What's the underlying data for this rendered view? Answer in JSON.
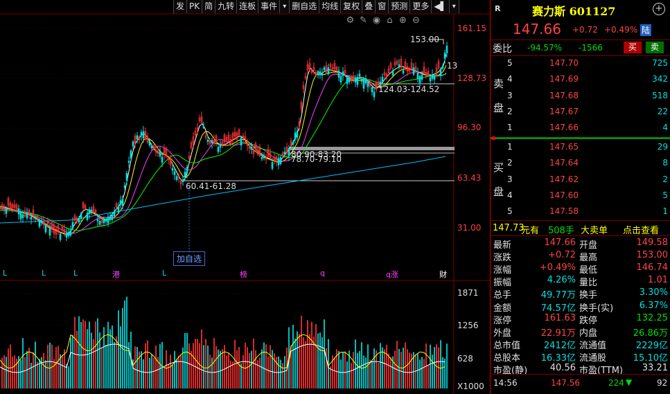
{
  "toolbar": [
    "发",
    "PK",
    "简",
    "九转",
    "连板",
    "事件",
    "▾",
    "删自选",
    "均线",
    "复权",
    "叠",
    "窗",
    "预测",
    "更多",
    "◀▌",
    "▾"
  ],
  "chart_icons": [
    "settings-icon",
    "brush-icon",
    "eye-icon",
    "house-icon",
    "zoom-in-icon",
    "zoom-out-icon"
  ],
  "price_axis": [
    "161.15",
    "128.73",
    "96.30",
    "63.43",
    "31.00"
  ],
  "volume_axis": [
    "1871",
    "1256",
    "628",
    "X1000"
  ],
  "annotations": {
    "high": "153.00",
    "range1": "124.03-124.52",
    "range2": "80.90-83.20",
    "range3": "78.70-79.10",
    "range4": "60.41-61.28",
    "cursor_label": "13",
    "add_watch": "加自选"
  },
  "markers": [
    {
      "t": "L",
      "c": "#00e0e0"
    },
    {
      "t": "L",
      "c": "#00e0e0"
    },
    {
      "t": "L",
      "c": "#00e0e0"
    },
    {
      "t": "港",
      "c": "#ff40ff"
    },
    {
      "t": "L",
      "c": "#00e0e0"
    },
    {
      "t": "榜",
      "c": "#ff40ff"
    },
    {
      "t": "q",
      "c": "#ff40ff"
    },
    {
      "t": "q涨",
      "c": "#ff40ff"
    },
    {
      "t": "财",
      "c": "#ffffff"
    }
  ],
  "stock": {
    "badge": "R",
    "name_code": "赛力斯 601127",
    "price": "147.66",
    "change": "+0.72",
    "pct": "+0.49%",
    "board": "陆",
    "ratio_label": "委比",
    "ratio": "-94.57%",
    "ratio_diff": "-1566",
    "sell_btn": "买",
    "buy_btn": "卖"
  },
  "asks": [
    {
      "lvl": "5",
      "price": "147.70",
      "vol": "725"
    },
    {
      "lvl": "4",
      "price": "147.69",
      "vol": "342"
    },
    {
      "lvl": "3",
      "price": "147.68",
      "vol": "518"
    },
    {
      "lvl": "2",
      "price": "147.67",
      "vol": "22"
    },
    {
      "lvl": "1",
      "price": "147.66",
      "vol": "4"
    }
  ],
  "bids": [
    {
      "lvl": "1",
      "price": "147.65",
      "vol": "29"
    },
    {
      "lvl": "2",
      "price": "147.64",
      "vol": "8"
    },
    {
      "lvl": "3",
      "price": "147.62",
      "vol": "2"
    },
    {
      "lvl": "4",
      "price": "147.60",
      "vol": "5"
    },
    {
      "lvl": "5",
      "price": "147.58",
      "vol": "1"
    }
  ],
  "ask_side": [
    "卖",
    "盘"
  ],
  "bid_side": [
    "买",
    "盘"
  ],
  "big_order": {
    "price": "147.73",
    "unit": "元有",
    "lots": "508手",
    "label": "大卖单",
    "action": "点击查看"
  },
  "stats": [
    {
      "l1": "最新",
      "v1": "147.66",
      "c1": "red",
      "l2": "开盘",
      "v2": "149.58",
      "c2": "red"
    },
    {
      "l1": "涨跌",
      "v1": "+0.72",
      "c1": "red",
      "l2": "最高",
      "v2": "153.00",
      "c2": "red"
    },
    {
      "l1": "涨幅",
      "v1": "+0.49%",
      "c1": "red",
      "l2": "最低",
      "v2": "146.74",
      "c2": "red"
    },
    {
      "l1": "振幅",
      "v1": "4.26%",
      "c1": "cyan",
      "l2": "量比",
      "v2": "1.01",
      "c2": "red"
    },
    {
      "l1": "总手",
      "v1": "49.77万",
      "c1": "cyan",
      "l2": "换手",
      "v2": "3.30%",
      "c2": "cyan"
    },
    {
      "l1": "金额",
      "v1": "74.57亿",
      "c1": "cyan",
      "l2": "换手(实)",
      "v2": "6.37%",
      "c2": "cyan"
    },
    {
      "l1": "涨停",
      "v1": "161.63",
      "c1": "red",
      "l2": "跌停",
      "v2": "132.25",
      "c2": "green"
    },
    {
      "l1": "外盘",
      "v1": "22.91万",
      "c1": "red",
      "l2": "内盘",
      "v2": "26.86万",
      "c2": "green"
    },
    {
      "l1": "总市值",
      "v1": "2412亿",
      "c1": "cyan",
      "l2": "流通值",
      "v2": "2229亿",
      "c2": "cyan"
    },
    {
      "l1": "总股本",
      "v1": "16.33亿",
      "c1": "cyan",
      "l2": "流通股",
      "v2": "15.10亿",
      "c2": "cyan"
    },
    {
      "l1": "市盈(静)",
      "v1": "40.56",
      "c1": "white",
      "l2": "市盈(TTM)",
      "v2": "33.21",
      "c2": "white"
    }
  ],
  "tick": {
    "time": "14:56",
    "price": "147.56",
    "vol": "224",
    "arrow": "▼",
    "count": "92"
  },
  "colors": {
    "up": "#ff3333",
    "down": "#00e0e0",
    "ma5": "#ffffff",
    "ma10": "#ffff00",
    "ma20": "#ff40ff",
    "ma30": "#00ff00",
    "ma250": "#00c0ff"
  }
}
